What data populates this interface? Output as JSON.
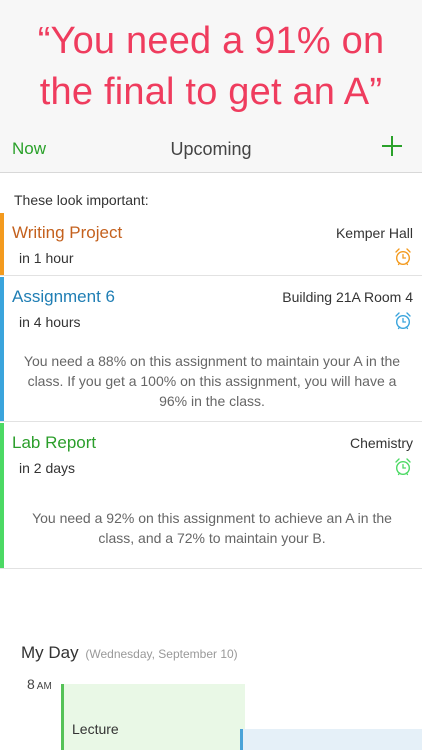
{
  "hero": {
    "line1": "“You need a 91% on",
    "line2": "the final to get an A”"
  },
  "nav": {
    "now_label": "Now",
    "title": "Upcoming",
    "add_icon": "plus-icon"
  },
  "section": {
    "label": "These look important:"
  },
  "cards": [
    {
      "title": "Writing Project",
      "location": "Kemper Hall",
      "due": "in 1 hour",
      "message": "",
      "color": "#f39a1e",
      "title_color": "#c4611e",
      "icon": "alarm-clock-icon"
    },
    {
      "title": "Assignment 6",
      "location": "Building 21A Room 4",
      "due": "in 4 hours",
      "message": "You need a 88% on this assignment to maintain your A in the class. If you get a 100% on this assignment, you will have a 96% in the class.",
      "color": "#3aa4dc",
      "title_color": "#1f7eb4",
      "icon": "alarm-clock-icon"
    },
    {
      "title": "Lab Report",
      "location": "Chemistry",
      "due": "in 2 days",
      "message": "You need a 92% on this assignment to achieve an A in the class, and a 72% to maintain your B.",
      "color": "#4cd964",
      "title_color": "#2b9e2b",
      "icon": "alarm-clock-icon"
    }
  ],
  "myday": {
    "title": "My Day",
    "date": "(Wednesday, September 10)",
    "hour": "8",
    "hour_suffix": "AM",
    "events": [
      {
        "label": "Lecture",
        "color": "#55c257"
      },
      {
        "label": "",
        "color": "#4aa3d8"
      }
    ]
  }
}
